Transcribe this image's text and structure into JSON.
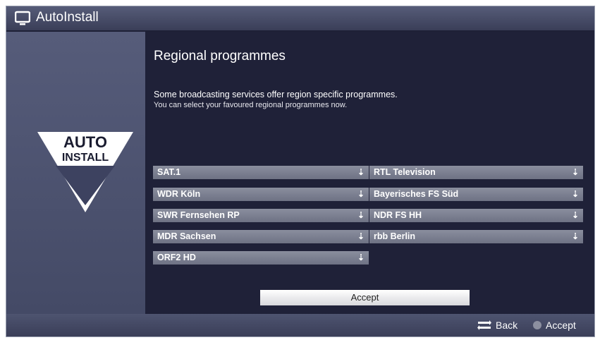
{
  "window": {
    "title": "AutoInstall",
    "title_icon": "tv-icon"
  },
  "logo": {
    "line1": "AUTO",
    "line2": "INSTALL"
  },
  "main": {
    "heading": "Regional programmes",
    "description_line1": "Some broadcasting services offer region specific programmes.",
    "description_line2": "You can select your favoured regional programmes now."
  },
  "dropdowns_left": [
    {
      "value": "SAT.1"
    },
    {
      "value": "WDR Köln"
    },
    {
      "value": "SWR Fernsehen RP"
    },
    {
      "value": "MDR Sachsen"
    },
    {
      "value": "ORF2 HD"
    }
  ],
  "dropdowns_right": [
    {
      "value": "RTL Television"
    },
    {
      "value": "Bayerisches FS Süd"
    },
    {
      "value": "NDR FS HH"
    },
    {
      "value": "rbb Berlin"
    }
  ],
  "dropdown_arrow": "⇣",
  "accept_button": {
    "label": "Accept"
  },
  "footer": {
    "back_label": "Back",
    "accept_label": "Accept"
  }
}
